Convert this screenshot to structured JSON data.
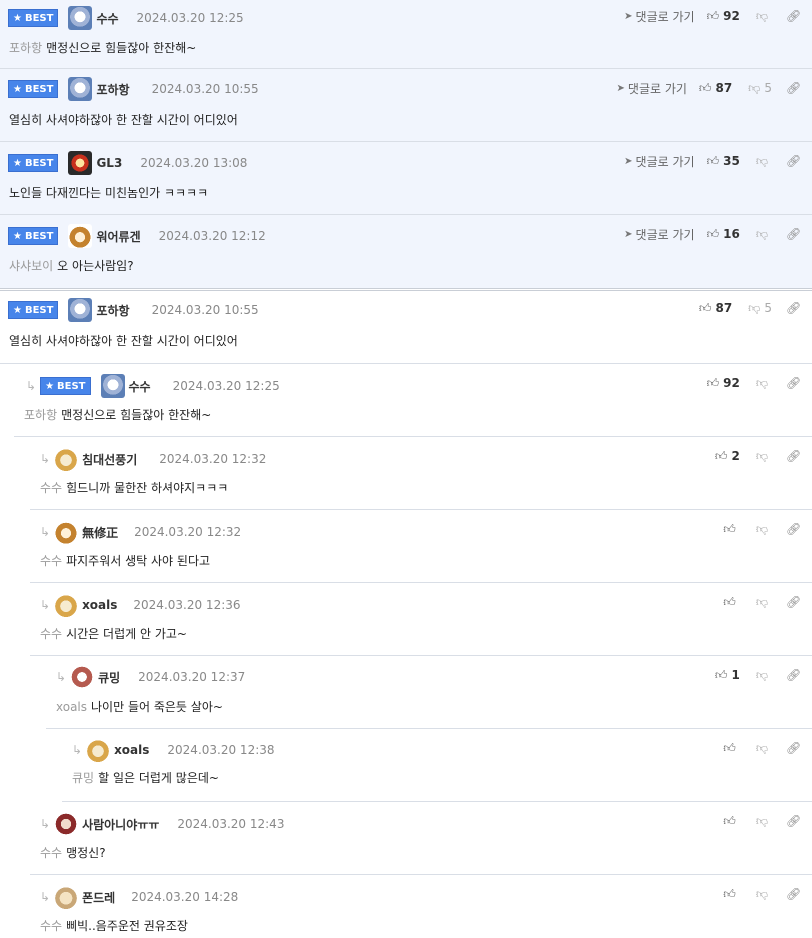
{
  "best": [
    {
      "badge": "BEST",
      "nick": "수수",
      "date": "2024.03.20 12:25",
      "goto": "댓글로 가기",
      "likes": "92",
      "dislikes": "",
      "mention": "포하항",
      "text": "맨정신으로 힘들잖아 한잔해~"
    },
    {
      "badge": "BEST",
      "nick": "포하항",
      "date": "2024.03.20 10:55",
      "goto": "댓글로 가기",
      "likes": "87",
      "dislikes": "5",
      "mention": "",
      "text": "열심히 사셔야하잖아 한 잔할 시간이 어디있어"
    },
    {
      "badge": "BEST",
      "nick": "GL3",
      "date": "2024.03.20 13:08",
      "goto": "댓글로 가기",
      "likes": "35",
      "dislikes": "",
      "mention": "",
      "text": "노인들 다재낀다는 미친놈인가 ㅋㅋㅋㅋ"
    },
    {
      "badge": "BEST",
      "nick": "워어류겐",
      "date": "2024.03.20 12:12",
      "goto": "댓글로 가기",
      "likes": "16",
      "dislikes": "",
      "mention": "샤샤보이",
      "text": "오 아는사람임?"
    }
  ],
  "thread": [
    {
      "badge": "BEST",
      "nick": "포하항",
      "date": "2024.03.20 10:55",
      "likes": "87",
      "dislikes": "5",
      "mention": "",
      "text": "열심히 사셔야하잖아 한 잔할 시간이 어디있어"
    },
    {
      "badge": "BEST",
      "nick": "수수",
      "date": "2024.03.20 12:25",
      "likes": "92",
      "dislikes": "",
      "mention": "포하항",
      "text": "맨정신으로 힘들잖아 한잔해~"
    },
    {
      "badge": "",
      "nick": "침대선풍기",
      "date": "2024.03.20 12:32",
      "likes": "2",
      "dislikes": "",
      "mention": "수수",
      "text": "힘드니까 물한잔 하셔야지ㅋㅋㅋ"
    },
    {
      "badge": "",
      "nick": "無修正",
      "date": "2024.03.20 12:32",
      "likes": "",
      "dislikes": "",
      "mention": "수수",
      "text": "파지주워서 생탁 사야 된다고"
    },
    {
      "badge": "",
      "nick": "xoals",
      "date": "2024.03.20 12:36",
      "likes": "",
      "dislikes": "",
      "mention": "수수",
      "text": "시간은 더럽게 안 가고~"
    },
    {
      "badge": "",
      "nick": "큐밍",
      "date": "2024.03.20 12:37",
      "likes": "1",
      "dislikes": "",
      "mention": "xoals",
      "text": "나이만 들어 죽은듯 살아~"
    },
    {
      "badge": "",
      "nick": "xoals",
      "date": "2024.03.20 12:38",
      "likes": "",
      "dislikes": "",
      "mention": "큐밍",
      "text": "할 일은 더럽게 많은데~"
    },
    {
      "badge": "",
      "nick": "사람아니야ㅠㅠ",
      "date": "2024.03.20 12:43",
      "likes": "",
      "dislikes": "",
      "mention": "수수",
      "text": "맹정신?"
    },
    {
      "badge": "",
      "nick": "폰드레",
      "date": "2024.03.20 14:28",
      "likes": "",
      "dislikes": "",
      "mention": "수수",
      "text": "삐빅..음주운전 권유조장"
    }
  ]
}
